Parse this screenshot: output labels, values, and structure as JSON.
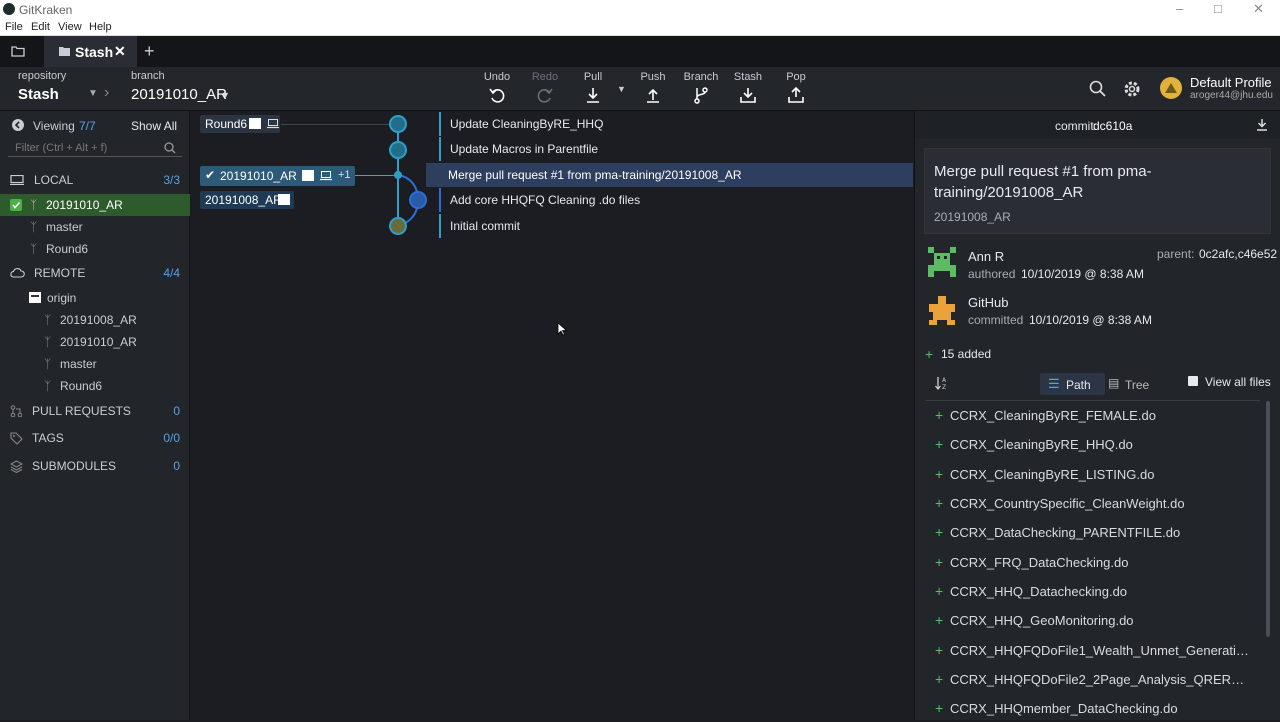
{
  "app": {
    "title": "GitKraken"
  },
  "menu": [
    "File",
    "Edit",
    "View",
    "Help"
  ],
  "tabs": {
    "active_tab": "Stash",
    "add_tab": "+"
  },
  "toolbar": {
    "repo_caption": "repository",
    "repo_name": "Stash",
    "branch_caption": "branch",
    "branch_name": "20191010_AR",
    "actions": [
      "Undo",
      "Redo",
      "Pull",
      "Push",
      "Branch",
      "Stash",
      "Pop"
    ],
    "profile_name": "Default Profile",
    "profile_email": "aroger44@jhu.edu"
  },
  "sidebar": {
    "viewing_label": "Viewing",
    "viewing_count": "7/7",
    "show_all": "Show All",
    "filter_placeholder": "Filter (Ctrl + Alt + f)",
    "local": {
      "label": "LOCAL",
      "count": "3/3",
      "branches": [
        "20191010_AR",
        "master",
        "Round6"
      ]
    },
    "remote": {
      "label": "REMOTE",
      "count": "4/4",
      "origin": "origin",
      "branches": [
        "20191008_AR",
        "20191010_AR",
        "master",
        "Round6"
      ]
    },
    "pull_requests": {
      "label": "PULL REQUESTS",
      "count": "0"
    },
    "tags": {
      "label": "TAGS",
      "count": "0/0"
    },
    "submodules": {
      "label": "SUBMODULES",
      "count": "0"
    }
  },
  "graph": {
    "refs": {
      "round6": "Round6",
      "head": "20191010_AR",
      "head_extra": "+1",
      "other": "20191008_AR"
    },
    "commits": [
      "Update CleaningByRE_HHQ",
      "Update Macros in Parentfile",
      "Merge pull request #1 from pma-training/20191008_AR",
      "Add core HHQFQ Cleaning .do files",
      "Initial commit"
    ]
  },
  "detail": {
    "commit_label": "commit:",
    "commit_sha": "dc610a",
    "message_title": "Merge pull request #1 from pma-training/20191008_AR",
    "message_body": "20191008_AR",
    "author_name": "Ann R",
    "authored_label": "authored",
    "authored_date": "10/10/2019 @ 8:38 AM",
    "parent_label": "parent:",
    "parent_shas": "0c2afc,c46e52",
    "committer_name": "GitHub",
    "committed_label": "committed",
    "committed_date": "10/10/2019 @ 8:38 AM",
    "added_summary": "15 added",
    "path_label": "Path",
    "tree_label": "Tree",
    "view_all_label": "View all files",
    "files": [
      "CCRX_CleaningByRE_FEMALE.do",
      "CCRX_CleaningByRE_HHQ.do",
      "CCRX_CleaningByRE_LISTING.do",
      "CCRX_CountrySpecific_CleanWeight.do",
      "CCRX_DataChecking_PARENTFILE.do",
      "CCRX_FRQ_DataChecking.do",
      "CCRX_HHQ_Datachecking.do",
      "CCRX_HHQ_GeoMonitoring.do",
      "CCRX_HHQFQDoFile1_Wealth_Unmet_Generatio...",
      "CCRX_HHQFQDoFile2_2Page_Analysis_QRERevisi...",
      "CCRX_HHQmember_DataChecking.do"
    ]
  }
}
